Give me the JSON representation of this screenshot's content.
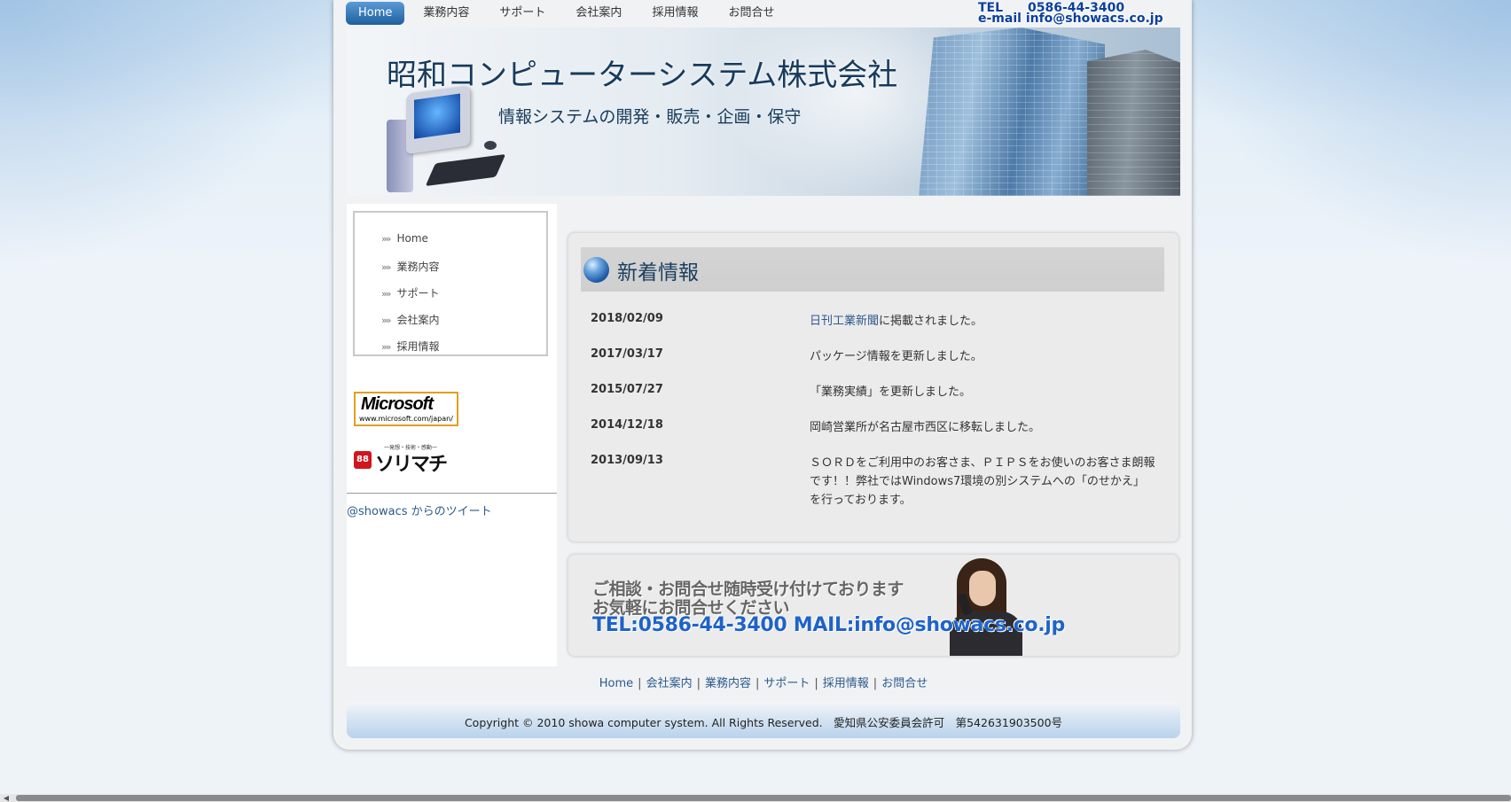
{
  "nav": {
    "items": [
      "Home",
      "業務内容",
      "サポート",
      "会社案内",
      "採用情報",
      "お問合せ"
    ]
  },
  "contact_top": {
    "tel": "TEL　　0586-44-3400",
    "email": "e-mail info@showacs.co.jp"
  },
  "banner": {
    "company_name": "昭和コンピューターシステム株式会社",
    "tagline": "情報システムの開発・販売・企画・保守"
  },
  "sidebar": {
    "menu": [
      "Home",
      "業務内容",
      "サポート",
      "会社案内",
      "採用情報"
    ],
    "microsoft_logo": "Microsoft",
    "microsoft_url": "www.microsoft.com/japan/",
    "sorimachi_logo": "ソリマチ",
    "sorimachi_sub": "一発想・技術・感動一",
    "tweets_link": "@showacs からのツイート"
  },
  "news": {
    "title": "新着情報",
    "items": [
      {
        "date": "2018/02/09",
        "link": "日刊工業新聞",
        "text": "に掲載されました。"
      },
      {
        "date": "2017/03/17",
        "link": "",
        "text": "パッケージ情報を更新しました。"
      },
      {
        "date": "2015/07/27",
        "link": "",
        "text": "「業務実績」を更新しました。"
      },
      {
        "date": "2014/12/18",
        "link": "",
        "text": "岡崎営業所が名古屋市西区に移転しました。"
      },
      {
        "date": "2013/09/13",
        "link": "",
        "text": "ＳＯＲＤをご利用中のお客さま、ＰＩＰＳをお使いのお客さま朗報です！！弊社ではWindows7環境の別システムへの「のせかえ」を行っております。"
      }
    ]
  },
  "contact_banner": {
    "line1": "ご相談・お問合せ随時受け付けております",
    "line2": "お気軽にお問合せください",
    "line3": "TEL:0586-44-3400 MAIL:info@showacs.co.jp"
  },
  "footer": {
    "links": [
      "Home",
      "会社案内",
      "業務内容",
      "サポート",
      "採用情報",
      "お問合せ"
    ],
    "separator": "|",
    "copyright": "Copyright © 2010 showa computer system. All Rights Reserved.　愛知県公安委員会許可　第542631903500号"
  },
  "colors": {
    "nav_active": "#1f5f9e",
    "link": "#2b5a8c",
    "title": "#1c3e5e",
    "contact_blue": "#1f63c8"
  }
}
